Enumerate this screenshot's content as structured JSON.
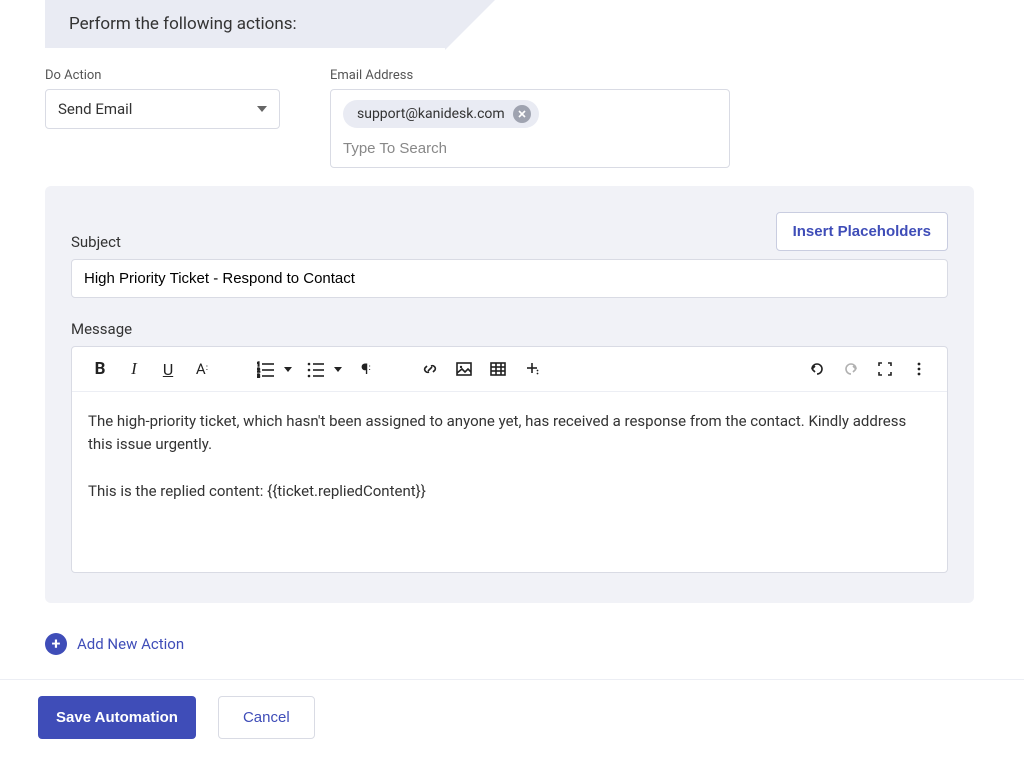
{
  "header": {
    "title": "Perform the following actions:"
  },
  "action": {
    "do_action_label": "Do Action",
    "do_action_value": "Send Email",
    "email_label": "Email Address",
    "email_chip": "support@kanidesk.com",
    "email_search_placeholder": "Type To Search"
  },
  "panel": {
    "subject_label": "Subject",
    "insert_placeholders": "Insert Placeholders",
    "subject_value": "High Priority Ticket - Respond to Contact",
    "message_label": "Message",
    "message_body": "The high-priority ticket, which hasn't been assigned to anyone yet, has received a response from the contact. Kindly address this issue urgently.\n\nThis is the replied content: {{ticket.repliedContent}}"
  },
  "add_action_label": "Add New Action",
  "footer": {
    "save": "Save Automation",
    "cancel": "Cancel"
  }
}
